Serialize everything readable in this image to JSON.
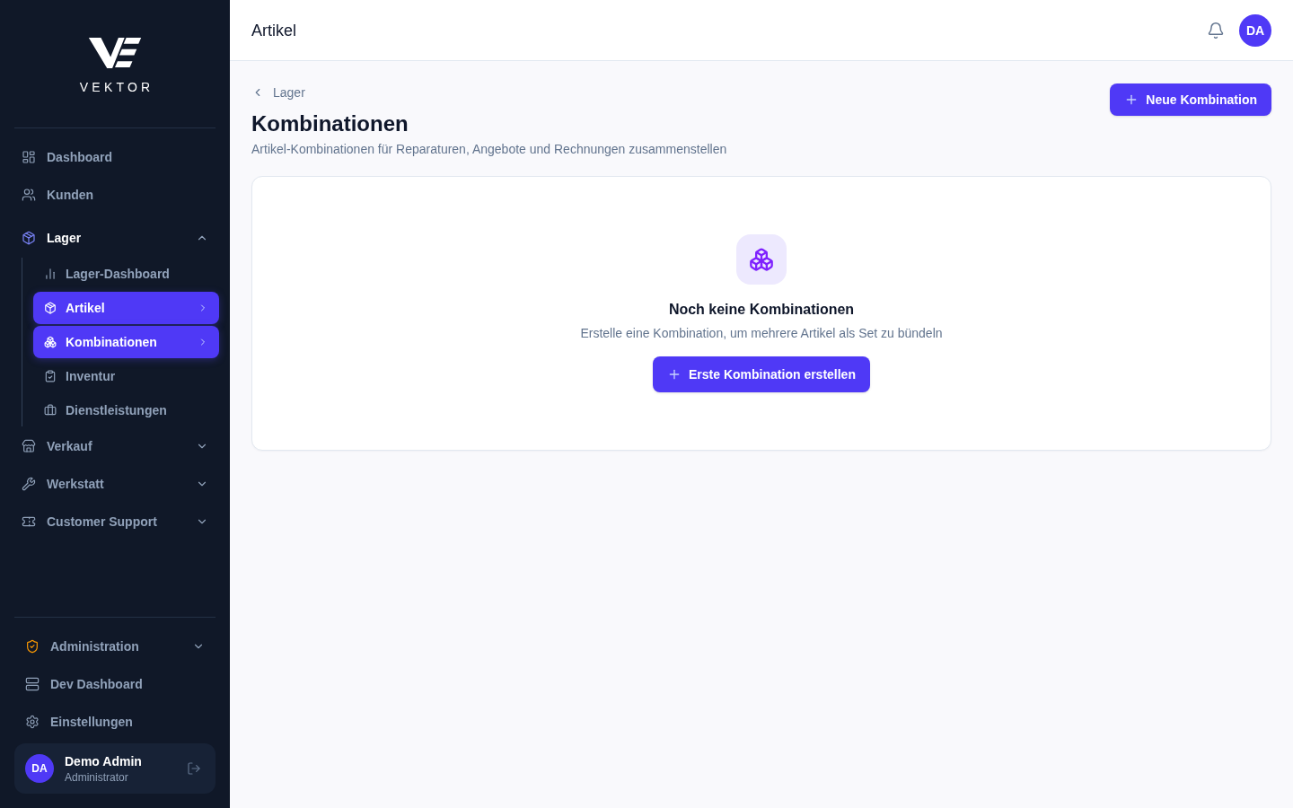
{
  "sidebar": {
    "logo": {
      "wordmark": "VEKTOR"
    },
    "nav": [
      {
        "kind": "link",
        "label": "Dashboard",
        "selected": false
      },
      {
        "kind": "link",
        "label": "Kunden",
        "selected": false
      },
      {
        "kind": "group",
        "label": "Lager",
        "selected": true,
        "expanded": true,
        "children": [
          {
            "label": "Lager-Dashboard",
            "selected": false
          },
          {
            "label": "Artikel",
            "selected": true
          },
          {
            "label": "Kombinationen",
            "selected": true
          },
          {
            "label": "Inventur",
            "selected": false
          },
          {
            "label": "Dienstleistungen",
            "selected": false
          }
        ]
      },
      {
        "kind": "group",
        "label": "Verkauf",
        "selected": false,
        "expanded": false
      },
      {
        "kind": "group",
        "label": "Werkstatt",
        "selected": false,
        "expanded": false
      },
      {
        "kind": "group",
        "label": "Customer Support",
        "selected": false,
        "expanded": false
      }
    ],
    "footer_nav": [
      {
        "kind": "group",
        "label": "Administration",
        "selected": false,
        "expanded": false
      },
      {
        "kind": "link",
        "label": "Dev Dashboard",
        "selected": false
      },
      {
        "kind": "link",
        "label": "Einstellungen",
        "selected": false
      }
    ],
    "user": {
      "initials": "DA",
      "name": "Demo Admin",
      "role": "Administrator"
    }
  },
  "header": {
    "title": "Artikel",
    "avatar_initials": "DA"
  },
  "page": {
    "breadcrumb": "Lager",
    "title": "Kombinationen",
    "subtitle": "Artikel-Kombinationen für Reparaturen, Angebote und Rechnungen zusammenstellen",
    "primary_button": "Neue Kombination"
  },
  "empty_state": {
    "title": "Noch keine Kombinationen",
    "text": "Erstelle eine Kombination, um mehrere Artikel als Set zu bündeln",
    "button": "Erste Kombination erstellen"
  }
}
